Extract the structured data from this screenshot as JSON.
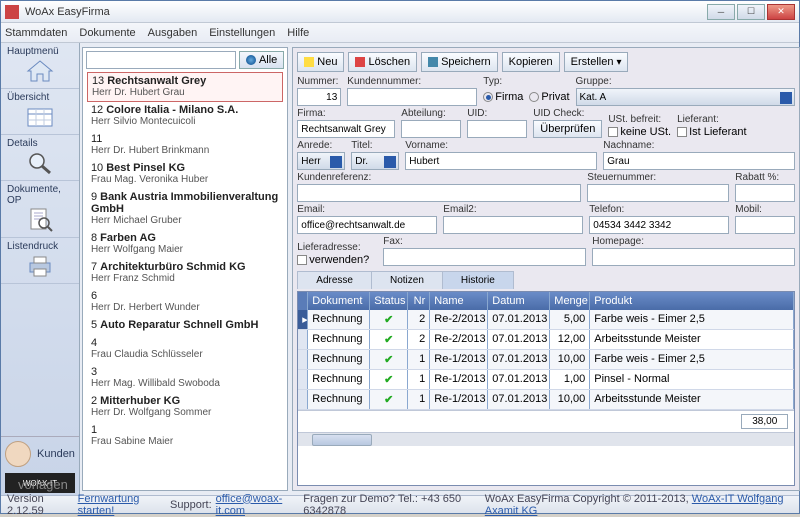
{
  "window": {
    "title": "WoAx EasyFirma"
  },
  "menubar": [
    "Stammdaten",
    "Dokumente",
    "Ausgaben",
    "Einstellungen",
    "Hilfe"
  ],
  "sidebar": {
    "items": [
      {
        "label": "Hauptmenü"
      },
      {
        "label": "Übersicht"
      },
      {
        "label": "Details"
      },
      {
        "label": "Dokumente, OP"
      },
      {
        "label": "Listendruck"
      }
    ],
    "kunden": "Kunden",
    "logo": "WOAX-IT"
  },
  "search": {
    "placeholder": "",
    "alle": "Alle"
  },
  "customers": [
    {
      "n": "13",
      "name": "Rechtsanwalt Grey",
      "sub": "Herr Dr. Hubert Grau",
      "sel": true
    },
    {
      "n": "12",
      "name": "Colore Italia - Milano S.A.",
      "sub": "Herr Silvio Montecuicoli"
    },
    {
      "n": "11",
      "name": "",
      "sub": "Herr Dr. Hubert Brinkmann"
    },
    {
      "n": "10",
      "name": "Best Pinsel KG",
      "sub": "Frau Mag. Veronika Huber"
    },
    {
      "n": "9",
      "name": "Bank Austria Immobilienveraltung GmbH",
      "sub": "Herr Michael Gruber"
    },
    {
      "n": "8",
      "name": "Farben AG",
      "sub": "Herr Wolfgang Maier"
    },
    {
      "n": "7",
      "name": "Architekturbüro Schmid KG",
      "sub": "Herr Franz Schmid"
    },
    {
      "n": "6",
      "name": "",
      "sub": "Herr Dr. Herbert Wunder"
    },
    {
      "n": "5",
      "name": "Auto Reparatur Schnell GmbH",
      "sub": ""
    },
    {
      "n": "4",
      "name": "",
      "sub": "Frau Claudia Schlüsseler"
    },
    {
      "n": "3",
      "name": "",
      "sub": "Herr Mag. Willibald Swoboda"
    },
    {
      "n": "2",
      "name": "Mitterhuber KG",
      "sub": "Herr Dr. Wolfgang Sommer"
    },
    {
      "n": "1",
      "name": "",
      "sub": "Frau Sabine Maier"
    }
  ],
  "toolbar": {
    "neu": "Neu",
    "loeschen": "Löschen",
    "speichern": "Speichern",
    "kopieren": "Kopieren",
    "erstellen": "Erstellen"
  },
  "form": {
    "nummer_lbl": "Nummer:",
    "nummer": "13",
    "kundennummer_lbl": "Kundennummer:",
    "kundennummer": "",
    "typ_lbl": "Typ:",
    "typ_firma": "Firma",
    "typ_privat": "Privat",
    "gruppe_lbl": "Gruppe:",
    "gruppe": "Kat. A",
    "firma_lbl": "Firma:",
    "firma": "Rechtsanwalt Grey",
    "abteilung_lbl": "Abteilung:",
    "abteilung": "",
    "uid_lbl": "UID:",
    "uid": "",
    "uidcheck_lbl": "UID Check:",
    "uidcheck_btn": "Überprüfen",
    "ust_lbl": "USt. befreit:",
    "ust_chk": "keine USt.",
    "lieferant_lbl": "Lieferant:",
    "lieferant_chk": "Ist Lieferant",
    "anrede_lbl": "Anrede:",
    "anrede": "Herr",
    "titel_lbl": "Titel:",
    "titel": "Dr.",
    "vorname_lbl": "Vorname:",
    "vorname": "Hubert",
    "nachname_lbl": "Nachname:",
    "nachname": "Grau",
    "kundenref_lbl": "Kundenreferenz:",
    "kundenref": "",
    "steuernr_lbl": "Steuernummer:",
    "steuernr": "",
    "rabatt_lbl": "Rabatt %:",
    "rabatt": "",
    "email_lbl": "Email:",
    "email": "office@rechtsanwalt.de",
    "email2_lbl": "Email2:",
    "email2": "",
    "telefon_lbl": "Telefon:",
    "telefon": "04534 3442 3342",
    "mobil_lbl": "Mobil:",
    "mobil": "",
    "lieferadr_lbl": "Lieferadresse:",
    "fax_lbl": "Fax:",
    "homepage_lbl": "Homepage:",
    "verwenden_lbl": "verwenden?",
    "fax": "",
    "homepage": ""
  },
  "tabs": {
    "adresse": "Adresse",
    "notizen": "Notizen",
    "historie": "Historie"
  },
  "grid": {
    "headers": {
      "dokument": "Dokument",
      "status": "Status",
      "nr": "Nr",
      "name": "Name",
      "datum": "Datum",
      "menge": "Menge",
      "produkt": "Produkt"
    },
    "rows": [
      {
        "dok": "Rechnung",
        "nr": "2",
        "name": "Re-2/2013",
        "datum": "07.01.2013",
        "menge": "5,00",
        "produkt": "Farbe weis - Eimer 2,5"
      },
      {
        "dok": "Rechnung",
        "nr": "2",
        "name": "Re-2/2013",
        "datum": "07.01.2013",
        "menge": "12,00",
        "produkt": "Arbeitsstunde Meister"
      },
      {
        "dok": "Rechnung",
        "nr": "1",
        "name": "Re-1/2013",
        "datum": "07.01.2013",
        "menge": "10,00",
        "produkt": "Farbe weis - Eimer 2,5"
      },
      {
        "dok": "Rechnung",
        "nr": "1",
        "name": "Re-1/2013",
        "datum": "07.01.2013",
        "menge": "1,00",
        "produkt": "Pinsel - Normal"
      },
      {
        "dok": "Rechnung",
        "nr": "1",
        "name": "Re-1/2013",
        "datum": "07.01.2013",
        "menge": "10,00",
        "produkt": "Arbeitsstunde Meister"
      }
    ],
    "total": "38,00"
  },
  "status": {
    "version": "Version 2.12.59",
    "fernwartung": "Fernwartung starten!",
    "support_lbl": "Support:",
    "support_email": "office@woax-it.com",
    "demo": "Fragen zur Demo? Tel.: +43 650 6342878",
    "copyright": "WoAx EasyFirma Copyright © 2011-2013,",
    "company": "WoAx-IT Wolfgang Axamit KG"
  },
  "watermark": "vorlagen"
}
